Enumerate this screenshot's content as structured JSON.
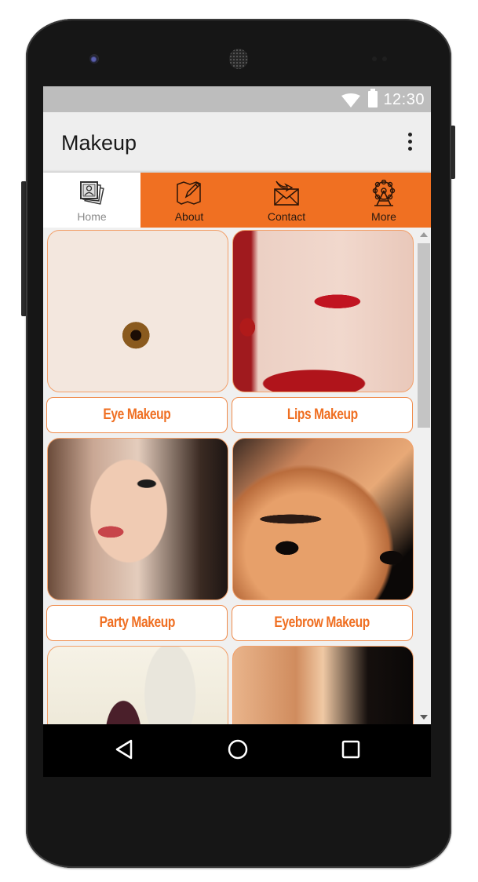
{
  "status_bar": {
    "time": "12:30",
    "icons": [
      "wifi-icon",
      "battery-icon"
    ]
  },
  "action_bar": {
    "title": "Makeup",
    "overflow_icon": "more-vert-icon"
  },
  "tabs": [
    {
      "label": "Home",
      "icon": "photo-album-icon",
      "active": true
    },
    {
      "label": "About",
      "icon": "map-pencil-icon",
      "active": false
    },
    {
      "label": "Contact",
      "icon": "envelope-arrow-icon",
      "active": false
    },
    {
      "label": "More",
      "icon": "ferris-wheel-icon",
      "active": false
    }
  ],
  "categories": [
    {
      "label": "Eye Makeup",
      "image": "eye-makeup-image"
    },
    {
      "label": "Lips Makeup",
      "image": "lips-makeup-image"
    },
    {
      "label": "Party Makeup",
      "image": "party-makeup-image"
    },
    {
      "label": "Eyebrow Makeup",
      "image": "eyebrow-makeup-image"
    },
    {
      "label": "",
      "image": "bridal-makeup-image"
    },
    {
      "label": "",
      "image": "smoky-eye-makeup-image"
    }
  ],
  "nav_bar": {
    "back": "back-icon",
    "home": "home-icon",
    "recents": "recents-icon"
  },
  "colors": {
    "accent": "#f07022",
    "label_text": "#ef6f22",
    "status_bar": "#bdbdbd",
    "action_bar": "#eeeeee"
  }
}
